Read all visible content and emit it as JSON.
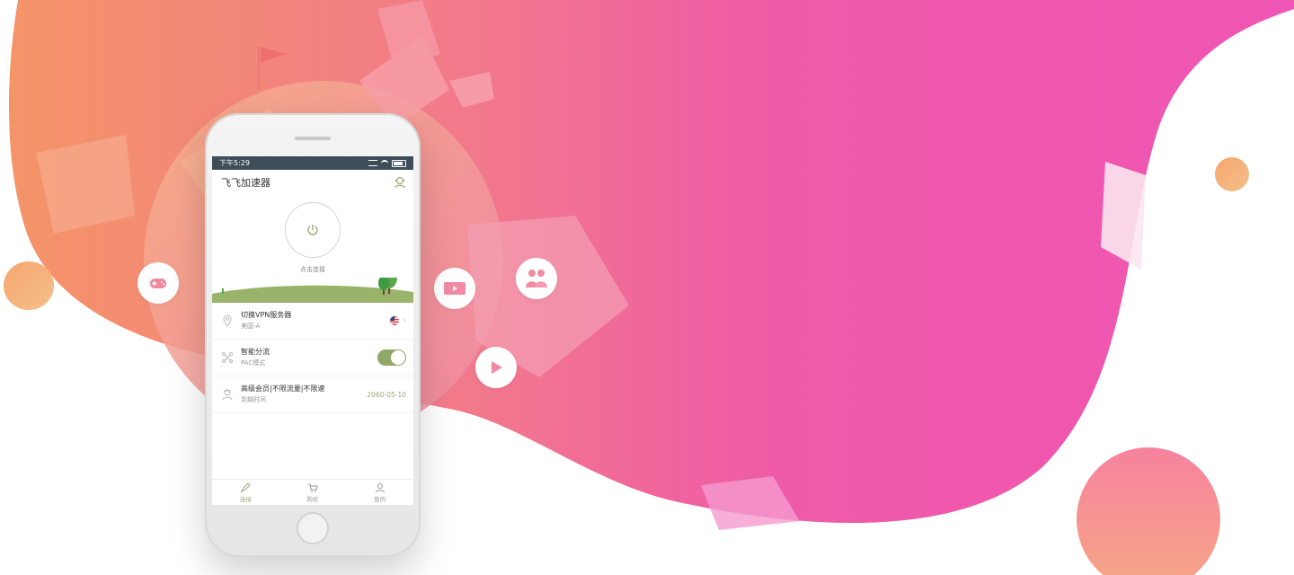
{
  "statusbar": {
    "time": "下午5:29"
  },
  "app": {
    "title": "飞飞加速器"
  },
  "hero": {
    "connect_label": "点击连接"
  },
  "rows": [
    {
      "title": "切换VPN服务器",
      "subtitle": "美国-A",
      "icon": "location-pin-icon"
    },
    {
      "title": "智能分流",
      "subtitle": "PAC模式",
      "icon": "network-icon",
      "toggle_on": true
    },
    {
      "title": "高级会员|不限流量|不限速",
      "subtitle": "到期时间",
      "icon": "member-icon",
      "value": "2060-05-10"
    }
  ],
  "tabs": [
    {
      "label": "连接",
      "icon": "rocket-icon",
      "active": true
    },
    {
      "label": "购买",
      "icon": "cart-icon",
      "active": false
    },
    {
      "label": "我的",
      "icon": "profile-icon",
      "active": false
    }
  ],
  "colors": {
    "accent": "#8fa865",
    "blob_start": "#f48f68",
    "blob_end": "#ef55b4",
    "statusbar": "#3d4e59"
  },
  "badges": [
    "gamepad-icon",
    "video-icon",
    "people-icon",
    "play-icon"
  ]
}
